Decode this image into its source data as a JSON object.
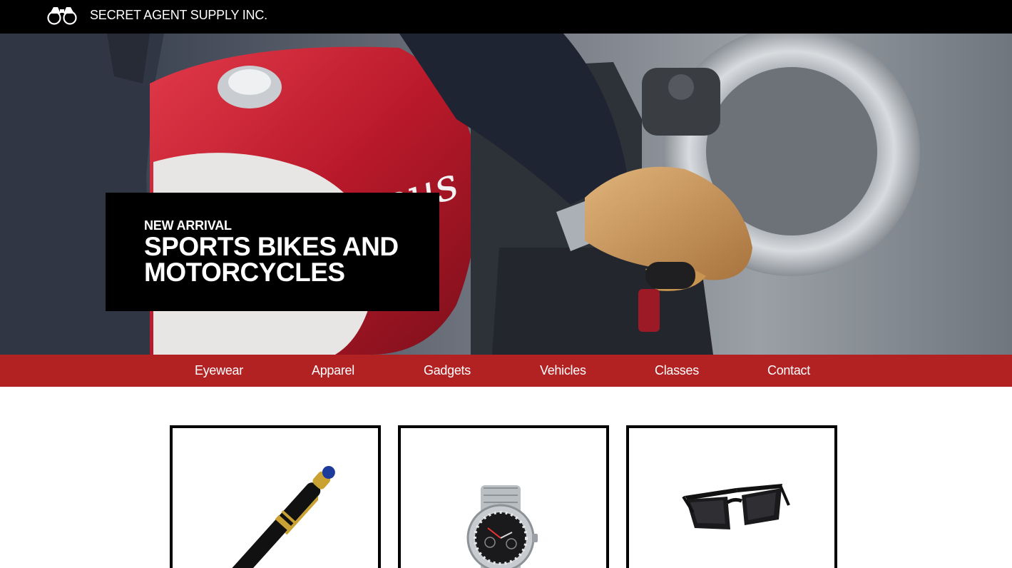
{
  "header": {
    "brand": "SECRET AGENT SUPPLY INC.",
    "logo_icon": "binoculars-icon"
  },
  "hero": {
    "eyebrow": "NEW ARRIVAL",
    "title": "SPORTS BIKES AND MOTORCYCLES",
    "tank_lettering": "Deus"
  },
  "nav": {
    "items": [
      {
        "label": "Eyewear"
      },
      {
        "label": "Apparel"
      },
      {
        "label": "Gadgets"
      },
      {
        "label": "Vehicles"
      },
      {
        "label": "Classes"
      },
      {
        "label": "Contact"
      }
    ]
  },
  "products": [
    {
      "image": "pen-icon"
    },
    {
      "image": "watch-icon"
    },
    {
      "image": "sunglasses-icon"
    }
  ],
  "colors": {
    "topbar": "#000000",
    "nav": "#b22222",
    "promo_box": "#000000",
    "card_border": "#000000"
  }
}
